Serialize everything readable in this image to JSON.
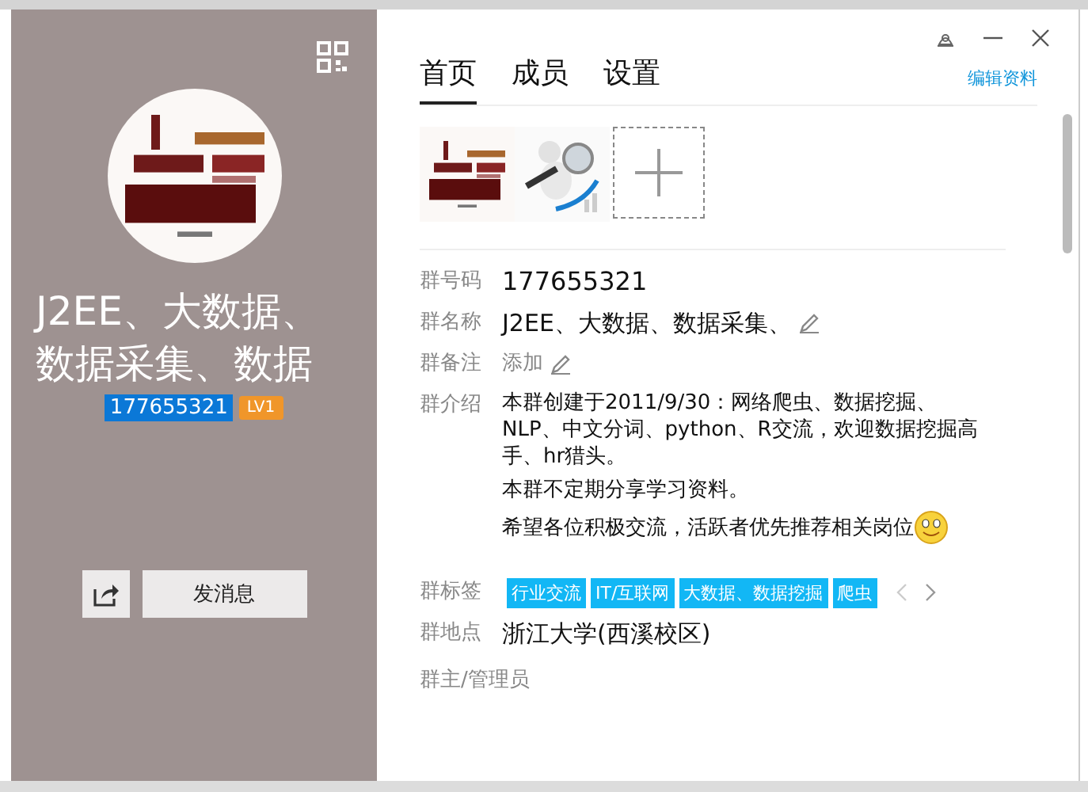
{
  "profile": {
    "title": "J2EE、大数据、数据采集、数据",
    "group_number": "177655321",
    "level_badge": "LV1",
    "message_button": "发消息"
  },
  "tabs": [
    {
      "label": "首页",
      "selected": true
    },
    {
      "label": "成员",
      "selected": false
    },
    {
      "label": "设置",
      "selected": false
    }
  ],
  "edit_link": "编辑资料",
  "fields": [
    {
      "kind": "number",
      "label": "群号码",
      "value": "177655321"
    },
    {
      "kind": "editable",
      "label": "群名称",
      "value": "J2EE、大数据、数据采集、"
    },
    {
      "kind": "add",
      "label": "群备注",
      "value": "添加"
    },
    {
      "kind": "intro",
      "label": "群介绍",
      "paragraphs": [
        "本群创建于2011/9/30：网络爬虫、数据挖掘、NLP、中文分词、python、R交流，欢迎数据挖掘高手、hr猎头。",
        "本群不定期分享学习资料。",
        "希望各位积极交流，活跃者优先推荐相关岗位"
      ]
    },
    {
      "kind": "tags",
      "label": "群标签",
      "tags": [
        "行业交流",
        "IT/互联网",
        "大数据、数据挖掘",
        "爬虫"
      ]
    },
    {
      "kind": "text",
      "label": "群地点",
      "value": "浙江大学(西溪校区)"
    }
  ],
  "admins_heading": "群主/管理员"
}
